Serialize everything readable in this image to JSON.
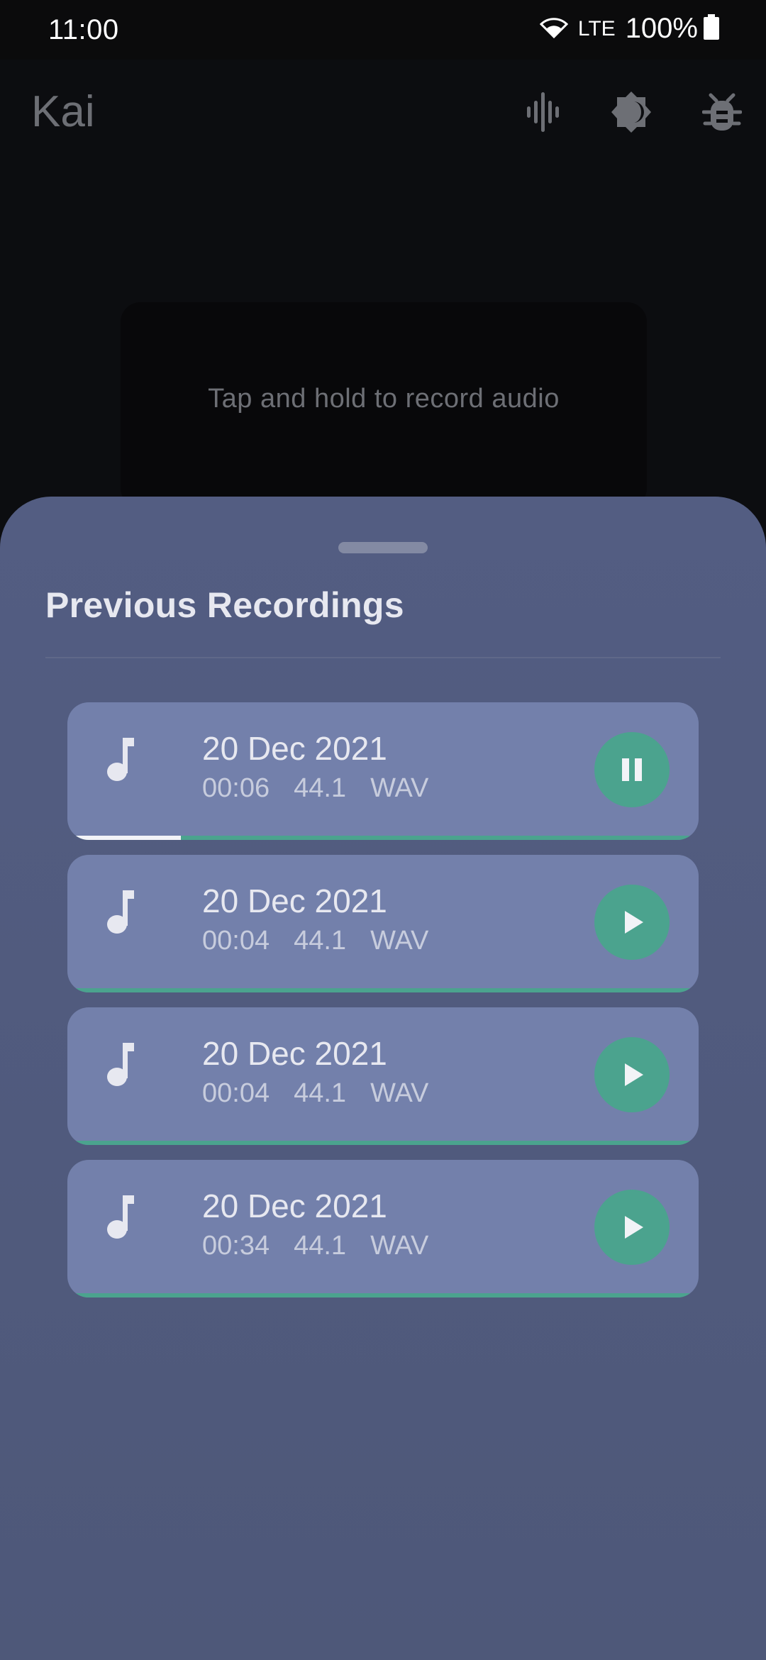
{
  "status_bar": {
    "time": "11:00",
    "network": "LTE",
    "battery": "100%"
  },
  "app_bar": {
    "title": "Kai",
    "icons": [
      "waveform-icon",
      "brightness-icon",
      "bug-icon"
    ]
  },
  "record_area": {
    "hint": "Tap and hold to record audio"
  },
  "sheet": {
    "title": "Previous Recordings",
    "recordings": [
      {
        "date": "20 Dec 2021",
        "duration": "00:06",
        "rate": "44.1",
        "format": "WAV",
        "state": "playing",
        "progress": 0.18
      },
      {
        "date": "20 Dec 2021",
        "duration": "00:04",
        "rate": "44.1",
        "format": "WAV",
        "state": "paused",
        "progress": 0
      },
      {
        "date": "20 Dec 2021",
        "duration": "00:04",
        "rate": "44.1",
        "format": "WAV",
        "state": "paused",
        "progress": 0
      },
      {
        "date": "20 Dec 2021",
        "duration": "00:34",
        "rate": "44.1",
        "format": "WAV",
        "state": "paused",
        "progress": 0
      }
    ]
  },
  "colors": {
    "background": "#0c0d10",
    "sheet": "#535d82",
    "card": "#7380ab",
    "accent": "#4ba38e",
    "muted_text": "#6d6f75"
  }
}
